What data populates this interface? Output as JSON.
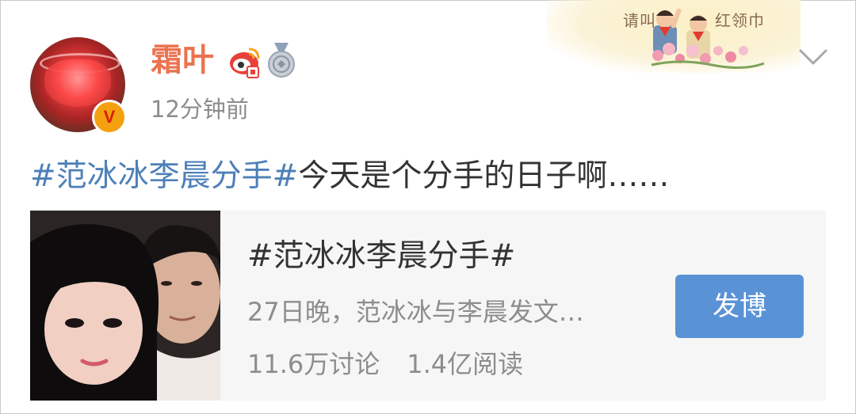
{
  "post": {
    "username": "霜叶",
    "timestamp": "12分钟前",
    "text_hashtag": "#范冰冰李晨分手#",
    "text_body": "今天是个分手的日子啊……"
  },
  "banner": {
    "text_left": "请叫我",
    "text_right": "红领巾"
  },
  "topic_card": {
    "title": "#范冰冰李晨分手#",
    "description": "27日晚，范冰冰与李晨发文…",
    "discussions": "11.6万讨论",
    "reads": "1.4亿阅读",
    "post_button_label": "发博"
  },
  "icons": [
    "verified-v-icon",
    "weibo-level-badge-icon",
    "silver-medal-badge-icon",
    "chevron-down-icon"
  ],
  "colors": {
    "username": "#eb7350",
    "hashtag": "#4e80b8",
    "post_button": "#5a92d6",
    "card_background": "#f6f6f6",
    "verified_badge": "#f3a10f"
  }
}
